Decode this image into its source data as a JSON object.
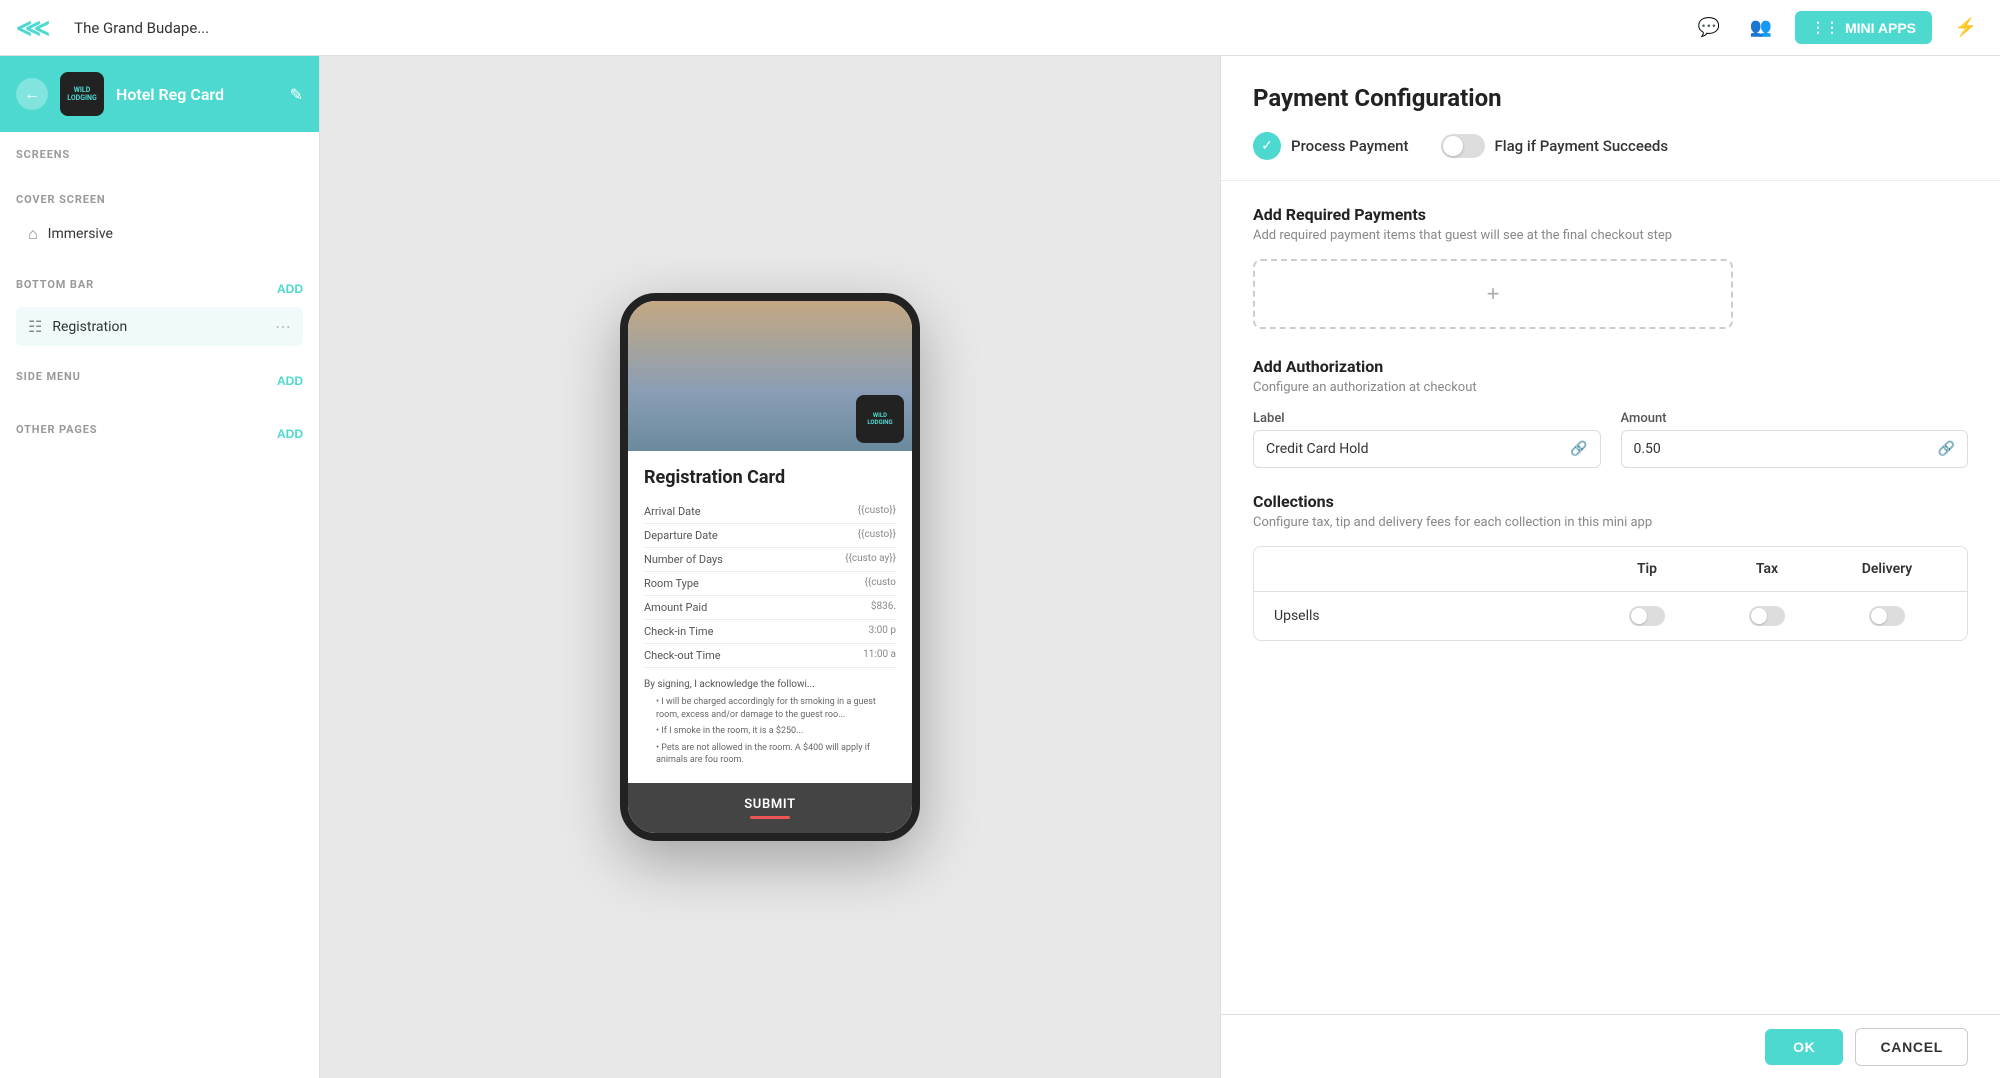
{
  "topNav": {
    "logo": "M",
    "appName": "The Grand Budape...",
    "miniAppsLabel": "MINI APPS"
  },
  "sidebar": {
    "appName": "Hotel Reg Card",
    "sections": {
      "screens": "SCREENS",
      "coverScreen": "COVER SCREEN",
      "coverItem": "Immersive",
      "bottomBar": "BOTTOM BAR",
      "bottomBarItem": "Registration",
      "sideMenu": "SIDE MENU",
      "otherPages": "OTHER PAGES"
    },
    "addLabels": {
      "bottomBar": "ADD",
      "sideMenu": "ADD",
      "otherPages": "ADD"
    }
  },
  "phone": {
    "title": "Registration Card",
    "formRows": [
      {
        "label": "Arrival Date",
        "value": "{{custo}}"
      },
      {
        "label": "Departure Date",
        "value": "{{custo}}"
      },
      {
        "label": "Number of Days",
        "value": "{{custo ay}}"
      },
      {
        "label": "Room Type",
        "value": "{{custo"
      },
      {
        "label": "Amount Paid",
        "value": "$836."
      },
      {
        "label": "Check-in Time",
        "value": "3:00 p"
      },
      {
        "label": "Check-out Time",
        "value": "11:00 a"
      }
    ],
    "signingText": "By signing, I acknowledge the followi...",
    "bullets": [
      "I will be charged accordingly for th smoking in a guest room, excess and/or damage to the guest roo...",
      "If I smoke in the room, it is a $250...",
      "Pets are not allowed in the room. A $400 will apply if animals are fou room."
    ],
    "submitLabel": "SUBMIT"
  },
  "rightPanel": {
    "title": "Payment Configuration",
    "processPayment": {
      "label": "Process Payment",
      "enabled": true
    },
    "flagIfPaymentSucceeds": {
      "label": "Flag if Payment Succeeds",
      "enabled": false
    },
    "addRequiredPayments": {
      "heading": "Add Required Payments",
      "subheading": "Add required payment items that guest will see at the final checkout step",
      "addButtonLabel": "+"
    },
    "addAuthorization": {
      "heading": "Add Authorization",
      "subheading": "Configure an authorization at checkout",
      "labelField": {
        "label": "Label",
        "value": "Credit Card Hold"
      },
      "amountField": {
        "label": "Amount",
        "value": "0.50"
      }
    },
    "collections": {
      "heading": "Collections",
      "subheading": "Configure tax, tip and delivery fees for each collection in this mini app",
      "columns": {
        "name": "",
        "tip": "Tip",
        "tax": "Tax",
        "delivery": "Delivery"
      },
      "rows": [
        {
          "name": "Upsells"
        }
      ]
    },
    "buttons": {
      "ok": "OK",
      "cancel": "CANCEL"
    }
  }
}
